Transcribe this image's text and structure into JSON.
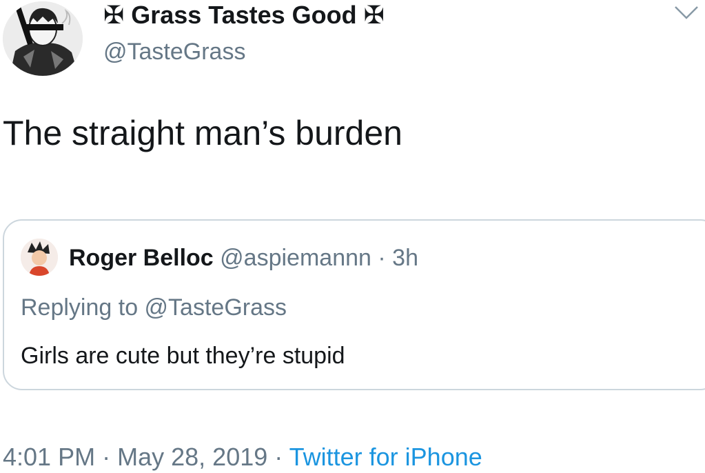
{
  "author": {
    "cross_left": "✠",
    "display_name": "Grass Tastes Good",
    "cross_right": "✠",
    "handle": "@TasteGrass"
  },
  "icons": {
    "menu": "chevron-down-icon",
    "author_avatar": "avatar-icon",
    "quoted_avatar": "avatar-icon"
  },
  "tweet": {
    "text": "The straight man’s burden"
  },
  "quoted": {
    "name": "Roger Belloc",
    "handle": "@aspiemannn",
    "separator": "·",
    "time": "3h",
    "replying_to": "Replying to @TasteGrass",
    "text": "Girls are cute but they’re stupid"
  },
  "footer": {
    "time": "4:01 PM",
    "sep1": "·",
    "date": "May 28, 2019",
    "sep2": "·",
    "source": "Twitter for iPhone"
  },
  "colors": {
    "text": "#14171a",
    "secondary": "#657786",
    "link": "#1b95e0",
    "border": "#ccd6dd"
  }
}
